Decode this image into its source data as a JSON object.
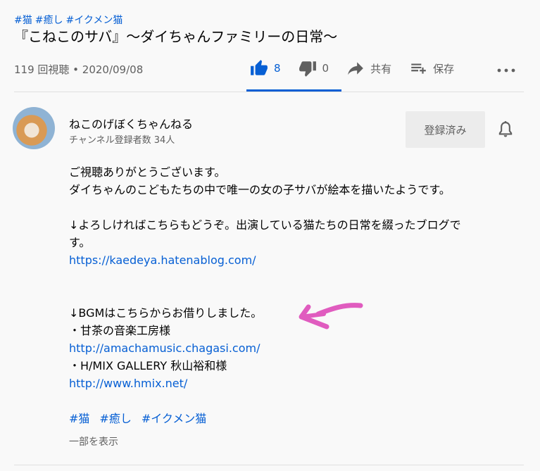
{
  "video": {
    "hashtags": [
      "#猫",
      "#癒し",
      "#イクメン猫"
    ],
    "title": "『こねこのサバ』～ダイちゃんファミリーの日常～",
    "views_date": "119 回視聴 • 2020/09/08"
  },
  "actions": {
    "like_count": "8",
    "dislike_count": "0",
    "share_label": "共有",
    "save_label": "保存",
    "like_icon": "thumb-up-icon",
    "dislike_icon": "thumb-down-icon",
    "share_icon": "share-icon",
    "save_icon": "playlist-add-icon",
    "more_icon": "more-horizontal-icon",
    "accent_color": "#065fd4"
  },
  "channel": {
    "name": "ねこのげぼくちゃんねる",
    "subscribers": "チャンネル登録者数 34人",
    "subscribe_label": "登録済み",
    "bell_icon": "bell-icon"
  },
  "description": {
    "line1": "ご視聴ありがとうございます。",
    "line2": "ダイちゃんのこどもたちの中で唯一の女の子サバが絵本を描いたようです。",
    "line3": "↓よろしければこちらもどうぞ。出演している猫たちの日常を綴ったブログで",
    "line4": "す。",
    "link1": "https://kaedeya.hatenablog.com/",
    "line5": "↓BGMはこちらからお借りしました。",
    "line6": "・甘茶の音楽工房様",
    "link2": "http://amachamusic.chagasi.com/",
    "line7": "・H/MIX GALLERY 秋山裕和様",
    "link3": "http://www.hmix.net/",
    "tags": [
      "#猫",
      "#癒し",
      "#イクメン猫"
    ],
    "show_more": "一部を表示"
  },
  "annotation": {
    "arrow_color": "#e05cbf"
  }
}
